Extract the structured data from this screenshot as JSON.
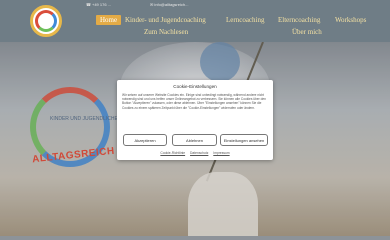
{
  "header": {
    "logo_alt": "",
    "phone": "+49 176 ...",
    "email": "info@alltagsreich...",
    "nav": {
      "home": "Home",
      "kinder": "Kinder- und Jugendcoaching",
      "lern": "Lerncoaching",
      "eltern": "Elterncoaching",
      "workshops": "Workshops",
      "nachlesen": "Zum Nachlesen",
      "ueber": "Über mich"
    }
  },
  "hero": {
    "badge_small": "KINDER UND JUGENDLICHE",
    "badge_text": "ALLTAGSREICH"
  },
  "cookie": {
    "title": "Cookie-Einstellungen",
    "body": "Wir setzen auf unserer Website Cookies ein. Einige sind unbedingt notwendig, während andere nicht notwendig sind und uns helfen unser Onlineangebot zu verbessern. Sie können alle Cookies über den Button \"Akzeptieren\" zulassen, oder diese ablehnen. Über \"Einstellungen ansehen\" können Sie die Cookies zu einem späteren Zeitpunkt über die \"Cookie-Einstellungen\" widerrufen oder ändern.",
    "accept": "Akzeptieren",
    "decline": "Ablehnen",
    "settings": "Einstellungen ansehen",
    "links": {
      "policy": "Cookie-Richtlinie",
      "privacy": "Datenschutz",
      "imprint": "Impressum"
    }
  }
}
